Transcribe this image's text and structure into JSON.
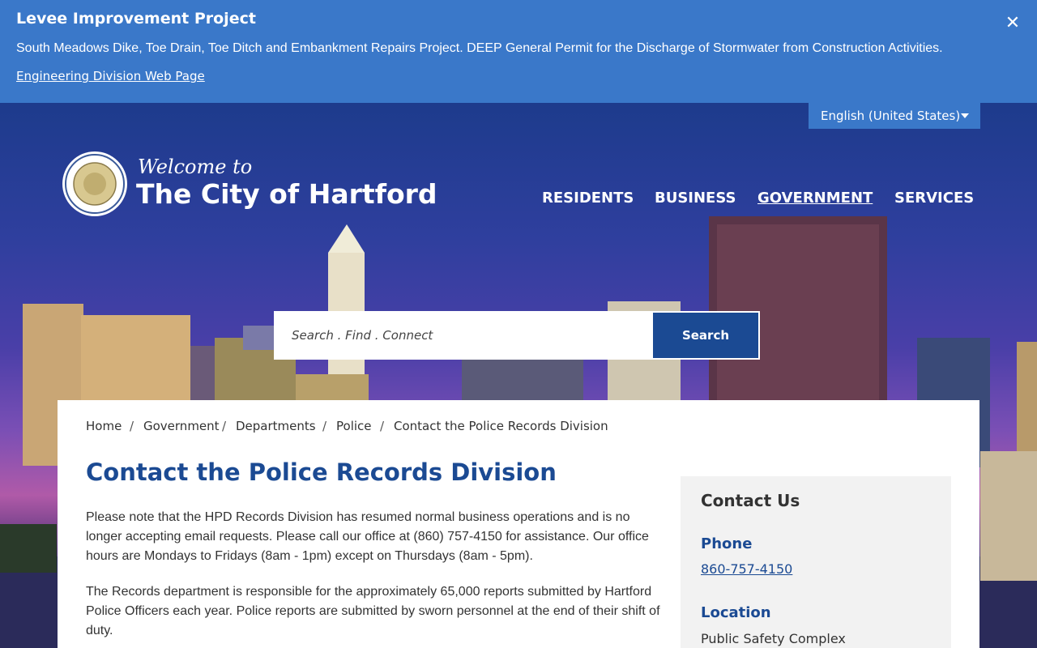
{
  "alert": {
    "title": "Levee Improvement Project",
    "body": "South Meadows Dike, Toe Drain, Toe Ditch and Embankment Repairs Project. DEEP General Permit for the Discharge of Stormwater from Construction Activities.",
    "link": "Engineering Division Web Page",
    "close_icon": "close-icon"
  },
  "language": {
    "selected": "English (United States)"
  },
  "branding": {
    "welcome": "Welcome to",
    "city_name": "The City of Hartford",
    "seal_icon": "city-seal-icon"
  },
  "nav": {
    "items": [
      "RESIDENTS",
      "BUSINESS",
      "GOVERNMENT",
      "SERVICES"
    ],
    "active": "GOVERNMENT"
  },
  "search": {
    "placeholder": "Search . Find . Connect",
    "button": "Search"
  },
  "breadcrumb": [
    "Home",
    "Government",
    "Departments",
    "Police",
    "Contact the Police Records Division"
  ],
  "main": {
    "title": "Contact the Police Records Division",
    "paragraphs": [
      "Please note that the HPD Records Division has resumed normal business operations and is no longer accepting email requests. Please call our office at (860) 757-4150 for assistance. Our office hours are Mondays to Fridays (8am - 1pm) except on Thursdays (8am - 5pm).",
      "The Records department is responsible for the approximately 65,000 reports submitted by Hartford Police Officers each year. Police reports are submitted by sworn personnel at the end of their shift of duty."
    ]
  },
  "sidebar": {
    "heading": "Contact Us",
    "phone_label": "Phone",
    "phone": "860-757-4150",
    "location_label": "Location",
    "location": "Public Safety Complex"
  },
  "colors": {
    "accent_blue": "#3a78c9",
    "brand_navy": "#1b4a93"
  }
}
